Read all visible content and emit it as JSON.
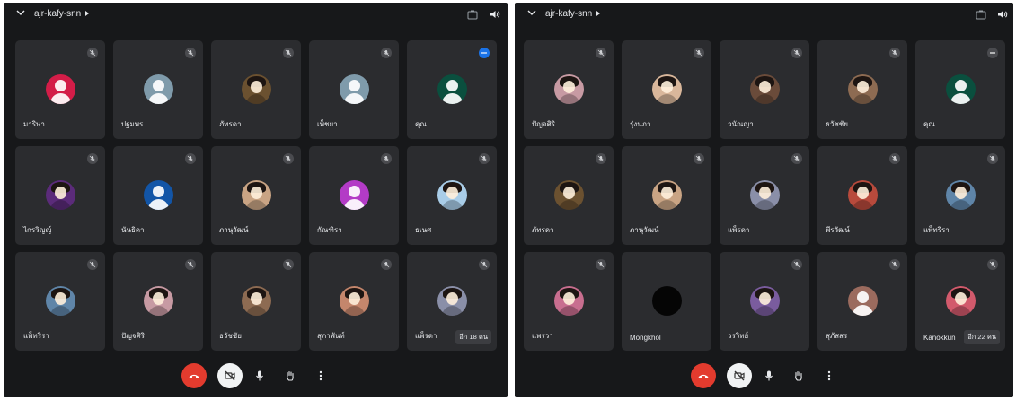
{
  "colors": {
    "panel_bg": "#17181a",
    "tile_bg": "#2b2c2f",
    "end_call": "#e33b2e",
    "camera_button": "#f1f3f4",
    "badge_blue": "#1a73e8"
  },
  "panels": [
    {
      "meeting_code": "ajr-kafy-snn",
      "tiles": [
        {
          "name": "มาริษา",
          "avatar": "initial",
          "color": "#d31d48",
          "mute_icon": "mic-off-icon"
        },
        {
          "name": "ปฐมพร",
          "avatar": "initial",
          "color": "#7f9bab",
          "mute_icon": "mic-off-icon"
        },
        {
          "name": "ภัทรดา",
          "avatar": "photo",
          "color": "#6b5130",
          "mute_icon": "mic-off-icon"
        },
        {
          "name": "เพ็ชยา",
          "avatar": "initial",
          "color": "#7f9bab",
          "mute_icon": "mic-off-icon"
        },
        {
          "name": "คุณ",
          "avatar": "initial",
          "color": "#0a4f3e",
          "mute_icon": "more-icon",
          "badge": "blue"
        },
        {
          "name": "ไกรวิญญ์",
          "avatar": "photo",
          "color": "#5b2b7a",
          "mute_icon": "mic-off-icon"
        },
        {
          "name": "นันธิดา",
          "avatar": "initial",
          "color": "#1255a7",
          "mute_icon": "mic-off-icon"
        },
        {
          "name": "ภานุวัฒน์",
          "avatar": "photo",
          "color": "#c9a484",
          "mute_icon": "mic-off-icon"
        },
        {
          "name": "กัณฑิรา",
          "avatar": "initial",
          "color": "#b33bc6",
          "mute_icon": "mic-off-icon"
        },
        {
          "name": "ธเนศ",
          "avatar": "photo",
          "color": "#a9cde8",
          "mute_icon": "mic-off-icon"
        },
        {
          "name": "แพ็ทริรา",
          "avatar": "photo",
          "color": "#5f85a8",
          "mute_icon": "mic-off-icon"
        },
        {
          "name": "ปัญจศิริ",
          "avatar": "photo",
          "color": "#c79aa3",
          "mute_icon": "mic-off-icon"
        },
        {
          "name": "ธวัชชัย",
          "avatar": "photo",
          "color": "#8d6b52",
          "mute_icon": "mic-off-icon"
        },
        {
          "name": "สุภาพันท์",
          "avatar": "photo",
          "color": "#c4866c",
          "mute_icon": "mic-off-icon"
        },
        {
          "name": "แพ็รดา",
          "avatar": "photo",
          "color": "#8a8fa8",
          "mute_icon": "mic-off-icon",
          "more": "อีก 18 คน"
        }
      ]
    },
    {
      "meeting_code": "ajr-kafy-snn",
      "tiles": [
        {
          "name": "ปัญจศิริ",
          "avatar": "photo",
          "color": "#c79aa3",
          "mute_icon": "mic-off-icon"
        },
        {
          "name": "รุ่งนภา",
          "avatar": "photo",
          "color": "#d9b79b",
          "mute_icon": "mic-off-icon"
        },
        {
          "name": "วนัณญา",
          "avatar": "photo",
          "color": "#6a4b3a",
          "mute_icon": "mic-off-icon"
        },
        {
          "name": "ธวัชชัย",
          "avatar": "photo",
          "color": "#8d6b52",
          "mute_icon": "mic-off-icon"
        },
        {
          "name": "คุณ",
          "avatar": "initial",
          "color": "#0a4f3e",
          "mute_icon": "more-icon"
        },
        {
          "name": "ภัทรดา",
          "avatar": "photo",
          "color": "#6b5130",
          "mute_icon": "mic-off-icon"
        },
        {
          "name": "ภานุวัฒน์",
          "avatar": "photo",
          "color": "#c9a484",
          "mute_icon": "mic-off-icon"
        },
        {
          "name": "แพ็รดา",
          "avatar": "photo",
          "color": "#8a8fa8",
          "mute_icon": "mic-off-icon"
        },
        {
          "name": "พีรวัฒน์",
          "avatar": "photo",
          "color": "#b84a3c",
          "mute_icon": "mic-off-icon"
        },
        {
          "name": "แพ็ทริรา",
          "avatar": "photo",
          "color": "#5f85a8",
          "mute_icon": "mic-off-icon"
        },
        {
          "name": "แพรวา",
          "avatar": "photo",
          "color": "#c86e8f",
          "mute_icon": "mic-off-icon"
        },
        {
          "name": "Mongkhol",
          "avatar": "dark",
          "color": "#050505",
          "mute_icon": "none"
        },
        {
          "name": "วรวิทย์",
          "avatar": "photo",
          "color": "#7a5c9e",
          "mute_icon": "mic-off-icon"
        },
        {
          "name": "สุภัสสร",
          "avatar": "initial",
          "color": "#9b6b5e",
          "mute_icon": "mic-off-icon"
        },
        {
          "name": "Kanokkun",
          "avatar": "photo",
          "color": "#d25a6c",
          "mute_icon": "mic-off-icon",
          "more": "อีก 22 คน"
        }
      ]
    }
  ],
  "controls": [
    "end-call-icon",
    "camera-off-icon",
    "mic-icon",
    "raise-hand-icon",
    "more-vert-icon"
  ]
}
